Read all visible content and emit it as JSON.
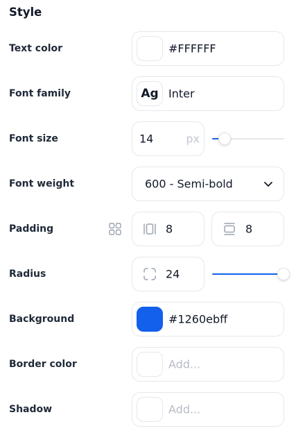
{
  "panel": {
    "title": "Style"
  },
  "text_color": {
    "label": "Text color",
    "value": "#FFFFFF",
    "swatch": "#FFFFFF"
  },
  "font_family": {
    "label": "Font family",
    "preview": "Ag",
    "value": "Inter"
  },
  "font_size": {
    "label": "Font size",
    "value": "14",
    "unit": "px",
    "slider_fraction": 0.1
  },
  "font_weight": {
    "label": "Font weight",
    "value": "600 - Semi-bold"
  },
  "padding": {
    "label": "Padding",
    "horizontal": "8",
    "vertical": "8"
  },
  "radius": {
    "label": "Radius",
    "value": "24",
    "slider_fraction": 1.0
  },
  "background": {
    "label": "Background",
    "value": "#1260ebff",
    "swatch": "#1260eb"
  },
  "border_color": {
    "label": "Border color",
    "placeholder": "Add..."
  },
  "shadow": {
    "label": "Shadow",
    "placeholder": "Add..."
  },
  "colors": {
    "accent": "#1260eb",
    "border": "#e5e7eb",
    "placeholder": "#b6bbc4"
  },
  "icons": [
    "padding-linked-grid-icon",
    "padding-horizontal-icon",
    "padding-vertical-icon",
    "radius-corners-icon",
    "chevron-down-icon"
  ]
}
